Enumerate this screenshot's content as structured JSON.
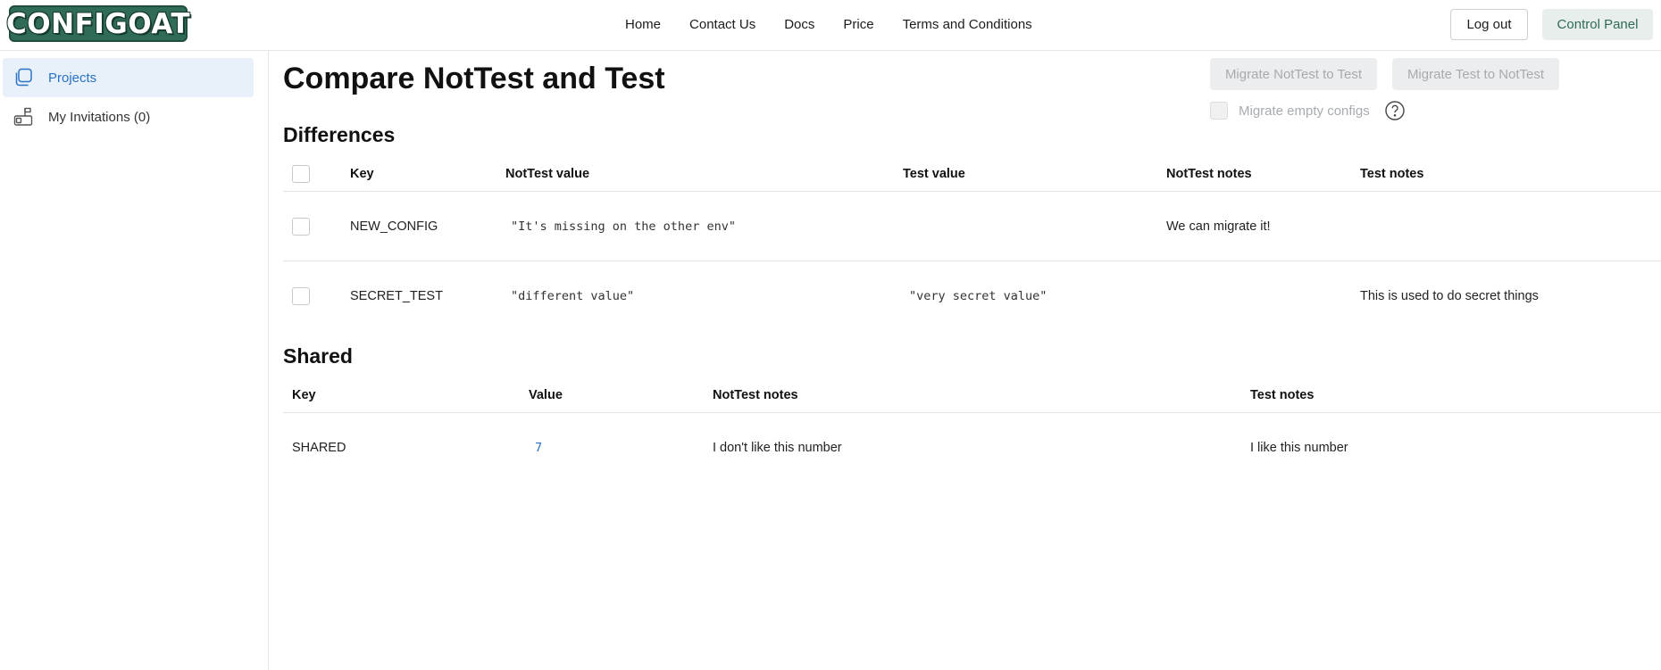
{
  "header": {
    "logo_text": "CONFIGOAT",
    "nav": [
      "Home",
      "Contact Us",
      "Docs",
      "Price",
      "Terms and Conditions"
    ],
    "logout_label": "Log out",
    "control_panel_label": "Control Panel"
  },
  "sidebar": {
    "items": [
      {
        "label": "Projects",
        "icon": "projects-icon",
        "active": true
      },
      {
        "label": "My Invitations (0)",
        "icon": "mailbox-icon",
        "active": false
      }
    ]
  },
  "page": {
    "title": "Compare NotTest and Test",
    "migrate_a_label": "Migrate NotTest to Test",
    "migrate_b_label": "Migrate Test to NotTest",
    "migrate_empty_label": "Migrate empty configs"
  },
  "differences": {
    "title": "Differences",
    "headers": {
      "key": "Key",
      "a_value": "NotTest value",
      "b_value": "Test value",
      "a_notes": "NotTest notes",
      "b_notes": "Test notes"
    },
    "rows": [
      {
        "key": "NEW_CONFIG",
        "a_value": "\"It's missing on the other env\"",
        "b_value": "",
        "a_notes": "We can migrate it!",
        "b_notes": ""
      },
      {
        "key": "SECRET_TEST",
        "a_value": "\"different value\"",
        "b_value": "\"very secret value\"",
        "a_notes": "",
        "b_notes": "This is used to do secret things"
      }
    ]
  },
  "shared": {
    "title": "Shared",
    "headers": {
      "key": "Key",
      "value": "Value",
      "a_notes": "NotTest notes",
      "b_notes": "Test notes"
    },
    "rows": [
      {
        "key": "SHARED",
        "value": "7",
        "a_notes": "I don't like this number",
        "b_notes": "I like this number"
      }
    ]
  },
  "colors": {
    "brand": "#2f6b57",
    "accent": "#2a72c6",
    "active_bg": "#e8f1fa"
  }
}
